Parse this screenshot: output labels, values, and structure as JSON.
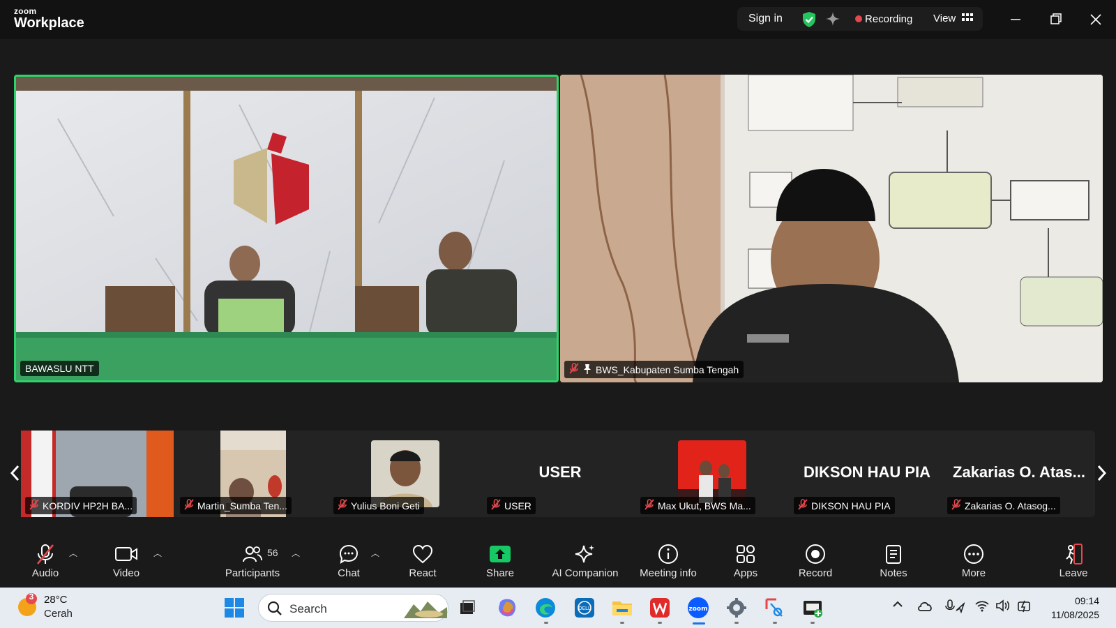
{
  "app": {
    "logo_small": "zoom",
    "logo_big": "Workplace"
  },
  "titlebar": {
    "sign_in": "Sign in",
    "recording": "Recording",
    "view": "View"
  },
  "main_tiles": [
    {
      "name": "BAWASLU NTT",
      "muted": false,
      "active_speaker": true
    },
    {
      "name": "BWS_Kabupaten Sumba Tengah",
      "muted": true,
      "pinned": true
    }
  ],
  "gallery": [
    {
      "name": "KORDIV HP2H BA...",
      "muted": true,
      "video": true
    },
    {
      "name": "Martin_Sumba Ten...",
      "muted": true,
      "video": true
    },
    {
      "name": "Yulius Boni Geti",
      "muted": true,
      "video": true
    },
    {
      "name": "USER",
      "muted": true,
      "video": false,
      "display": "USER"
    },
    {
      "name": "Max Ukut, BWS Ma...",
      "muted": true,
      "video": true
    },
    {
      "name": "DIKSON HAU PIA",
      "muted": true,
      "video": false,
      "display": "DIKSON HAU PIA"
    },
    {
      "name": "Zakarias O. Atasog...",
      "muted": true,
      "video": false,
      "display": "Zakarias O. Atas..."
    }
  ],
  "toolbar": {
    "audio": "Audio",
    "video": "Video",
    "participants": "Participants",
    "participants_count": "56",
    "chat": "Chat",
    "react": "React",
    "share": "Share",
    "ai_companion": "AI Companion",
    "meeting_info": "Meeting info",
    "apps": "Apps",
    "record": "Record",
    "notes": "Notes",
    "more": "More",
    "leave": "Leave"
  },
  "taskbar": {
    "weather_badge": "3",
    "temp": "28°C",
    "condition": "Cerah",
    "search_placeholder": "Search",
    "time": "09:14",
    "date": "11/08/2025"
  },
  "colors": {
    "active_speaker_border": "#2fd36b",
    "share_green": "#17c964",
    "recording_red": "#e5484d",
    "leave_red": "#e5484d"
  }
}
